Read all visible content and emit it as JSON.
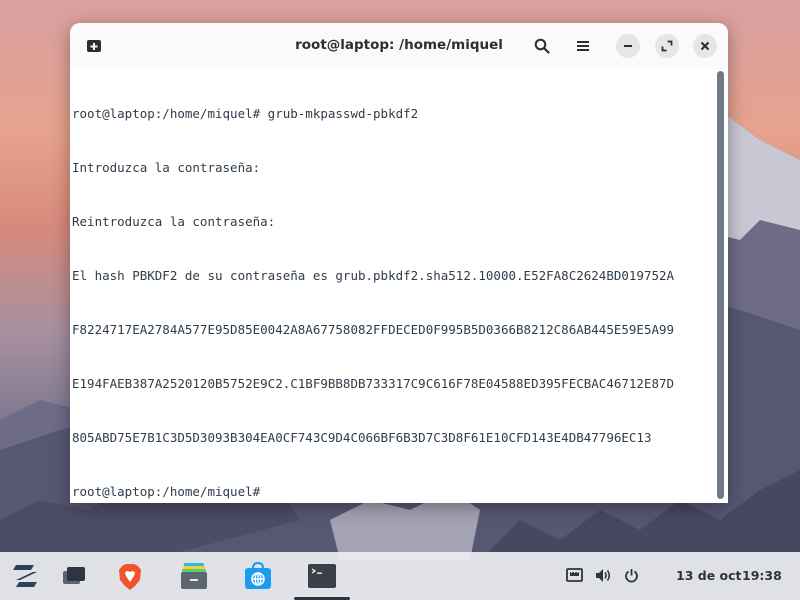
{
  "window": {
    "title": "root@laptop: /home/miquel"
  },
  "terminal": {
    "lines": [
      "root@laptop:/home/miquel# grub-mkpasswd-pbkdf2",
      "Introduzca la contraseña:",
      "Reintroduzca la contraseña:",
      "El hash PBKDF2 de su contraseña es grub.pbkdf2.sha512.10000.E52FA8C2624BD019752A",
      "F8224717EA2784A577E95D85E0042A8A67758082FFDECED0F995B5D0366B8212C86AB445E59E5A99",
      "E194FAEB387A2520120B5752E9C2.C1BF9BB8DB733317C9C616F78E04588ED395FECBAC46712E87D",
      "805ABD75E7B1C3D5D3093B304EA0CF743C9D4C066BF6B3D7C3D8F61E10CFD143E4DB47796EC13",
      "root@laptop:/home/miquel#"
    ]
  },
  "taskbar": {
    "apps": [
      "zorin-menu-icon",
      "workspaces-icon",
      "brave-browser-icon",
      "files-icon",
      "software-store-icon",
      "terminal-icon"
    ],
    "date": "13 de oct",
    "time": "19:38"
  },
  "colors": {
    "terminal_text": "#2f3d4a",
    "taskbar": "#ecedf1",
    "brave": "#f0542b",
    "store": "#1d9bf0"
  }
}
